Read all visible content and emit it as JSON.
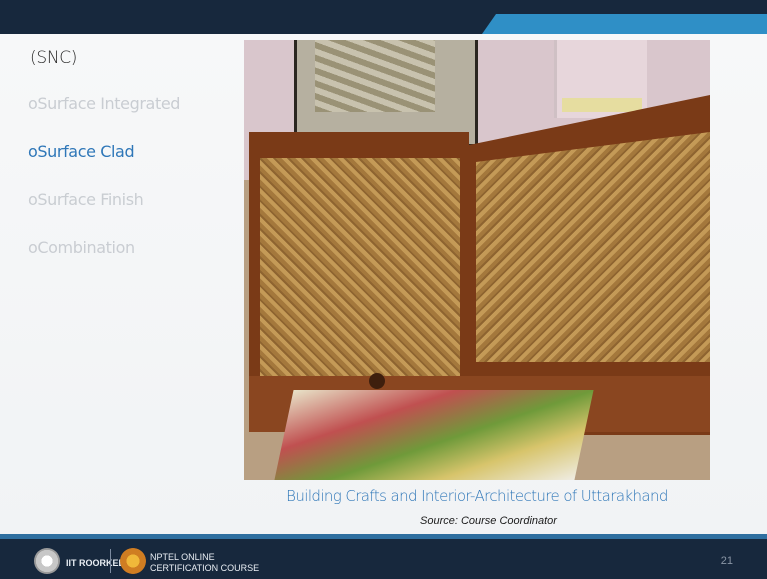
{
  "slide": {
    "title": "(SNC)",
    "bullets": [
      {
        "label": "oSurface Integrated",
        "active": false
      },
      {
        "label": "oSurface Clad",
        "active": true
      },
      {
        "label": "oSurface Finish",
        "active": false
      },
      {
        "label": "oCombination",
        "active": false
      }
    ],
    "caption": "Building Crafts and Interior-Architecture of Uttarakhand",
    "source": "Source: Course Coordinator",
    "page_number": "21"
  },
  "footer": {
    "institute": "IIT ROORKEE",
    "course_line1": "NPTEL ONLINE",
    "course_line2": "CERTIFICATION COURSE"
  },
  "colors": {
    "header": "#17283d",
    "accent": "#2f8fc6",
    "active_bullet": "#2f77b8",
    "inactive_bullet": "#c9cdd2"
  },
  "icons": [
    "iit-roorkee-logo-icon",
    "nptel-logo-icon"
  ]
}
